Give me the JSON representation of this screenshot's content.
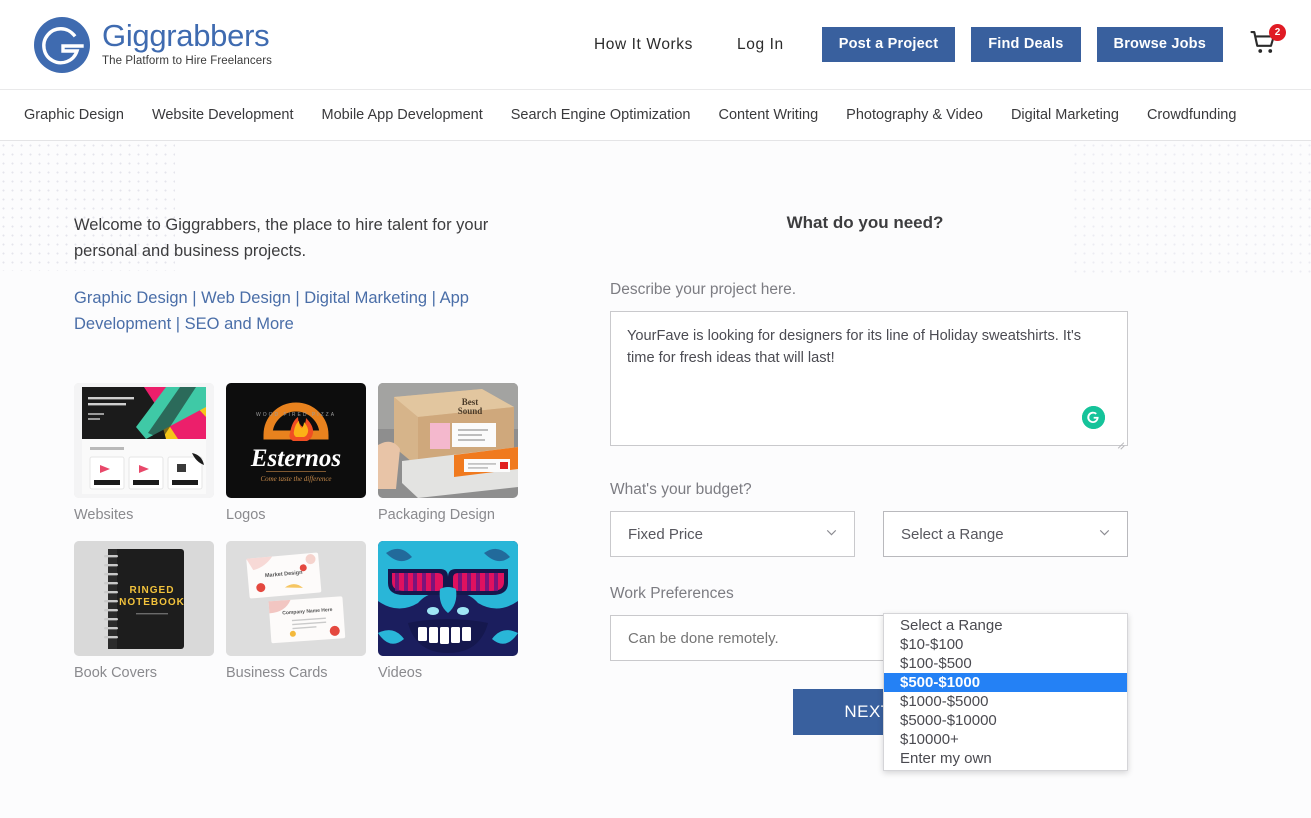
{
  "brand": {
    "name": "Giggrabbers",
    "tagline": "The Platform to Hire Freelancers",
    "logo_color": "#3f6bb0",
    "button_color": "#39609e",
    "highlight_color": "#2481f5"
  },
  "header": {
    "links": [
      {
        "label": "How It Works"
      },
      {
        "label": "Log In"
      }
    ],
    "buttons": [
      {
        "label": "Post a Project"
      },
      {
        "label": "Find Deals"
      },
      {
        "label": "Browse Jobs"
      }
    ],
    "cart": {
      "icon": "shopping-cart-icon",
      "count": "2",
      "badge_color": "#e01b24"
    }
  },
  "categories": [
    {
      "label": "Graphic Design"
    },
    {
      "label": "Website Development"
    },
    {
      "label": "Mobile App Development"
    },
    {
      "label": "Search Engine Optimization"
    },
    {
      "label": "Content Writing"
    },
    {
      "label": "Photography & Video"
    },
    {
      "label": "Digital Marketing"
    },
    {
      "label": "Crowdfunding"
    }
  ],
  "left": {
    "welcome": "Welcome to Giggrabbers, the place to hire talent for your personal and business projects.",
    "services_line": "Graphic Design | Web Design | Digital Marketing | App Development | SEO and More",
    "thumbs": [
      {
        "label": "Websites"
      },
      {
        "label": "Logos"
      },
      {
        "label": "Packaging Design"
      },
      {
        "label": "Book Covers"
      },
      {
        "label": "Business Cards"
      },
      {
        "label": "Videos"
      }
    ]
  },
  "form": {
    "title": "What do you need?",
    "describe_label": "Describe your project here.",
    "describe_value": "YourFave is looking for designers for its line of Holiday sweatshirts. It's time for fresh ideas that will last!",
    "describe_placeholder": "Describe your project here.",
    "grammarly_icon": "grammarly-icon",
    "budget_label": "What's your budget?",
    "price_type_value": "Fixed Price",
    "range_value": "Select a Range",
    "range_options": [
      {
        "label": "Select a Range",
        "selected": false
      },
      {
        "label": "$10-$100",
        "selected": false
      },
      {
        "label": "$100-$500",
        "selected": false
      },
      {
        "label": "$500-$1000",
        "selected": true
      },
      {
        "label": "$1000-$5000",
        "selected": false
      },
      {
        "label": "$5000-$10000",
        "selected": false
      },
      {
        "label": "$10000+",
        "selected": false
      },
      {
        "label": "Enter my own",
        "selected": false
      }
    ],
    "work_pref_label": "Work Preferences",
    "work_pref_value": "Can be done remotely.",
    "work_pref_placeholder": "Can be done remotely.",
    "next_label": "NEXT"
  }
}
